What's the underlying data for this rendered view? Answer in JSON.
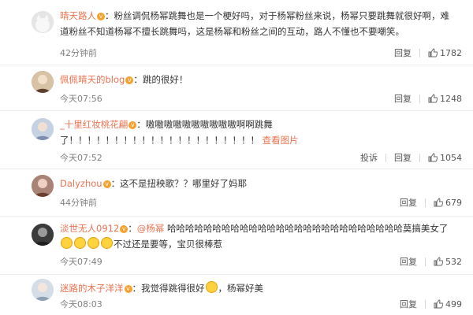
{
  "comments": [
    {
      "user": "晴天路人",
      "text": "：粉丝调侃杨幂跳舞也是一个梗好吗，对于杨幂粉丝来说，杨幂只要跳舞就很好啊，难道粉丝不知道杨幂不擅长跳舞吗，这是杨幂和粉丝之间的互动，路人不懂也不要嘲笑。",
      "time": "42分钟前",
      "reply": "回复",
      "likes": "1782"
    },
    {
      "user": "佩佩晴天的blog",
      "text": "：跳的很好！",
      "time": "今天07:56",
      "reply": "回复",
      "likes": "1248"
    },
    {
      "user": "_十里红妆桃花翩",
      "text": "：嗷嗷嗷嗷嗷嗷嗷嗷嗷嗷啊啊跳舞了！！！！！！！！！！！！！！！！！！！！！",
      "link": "查看图片",
      "time": "今天07:52",
      "report": "投诉",
      "reply": "回复",
      "likes": "1054"
    },
    {
      "user": "Dalyzhou",
      "text": "：这不是扭秧歌？？哪里好了妈耶",
      "time": "44分钟前",
      "reply": "回复",
      "likes": "679"
    },
    {
      "user": "淡世无人0912",
      "mention": "@杨幂",
      "text": "哈哈哈哈哈哈哈哈哈哈哈哈哈哈哈哈哈哈哈哈哈哈哈哈哈哈莫搞美女了",
      "text2": "不过还是要等，宝贝很棒惹",
      "time": "今天07:49",
      "reply": "回复",
      "likes": "532"
    },
    {
      "user": "迷路的木子洋洋",
      "text": "：我觉得跳得很好",
      "text2": "，杨幂好美",
      "time": "今天08:03",
      "reply": "回复",
      "likes": "499"
    }
  ],
  "colors": {
    "name": "#eb7350",
    "text": "#333333",
    "time": "#808080",
    "vip": "#f6a12b"
  }
}
